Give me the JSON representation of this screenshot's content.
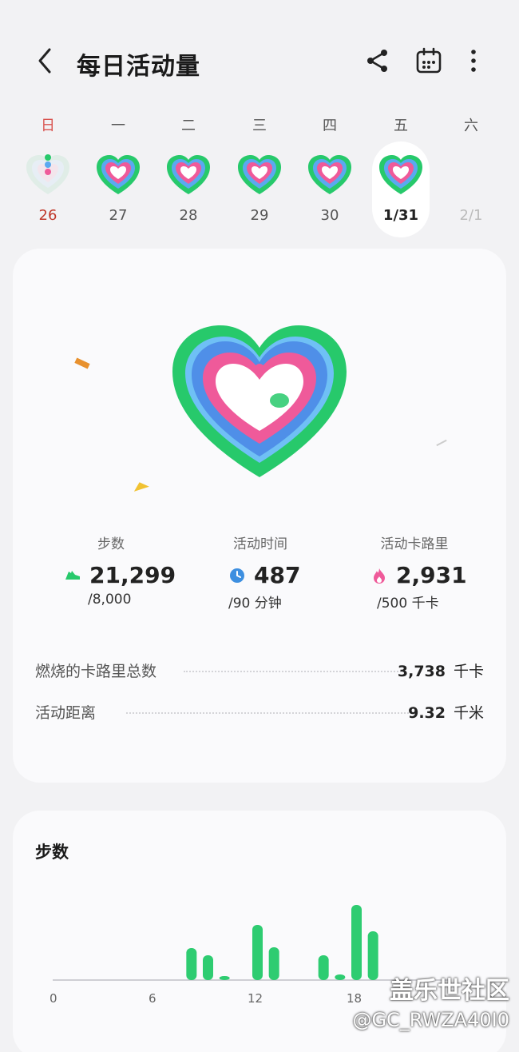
{
  "header": {
    "title": "每日活动量",
    "icons": [
      "back-chevron-icon",
      "share-icon",
      "calendar-icon",
      "more-vertical-icon"
    ]
  },
  "week": {
    "days": [
      {
        "dow": "日",
        "date": "26",
        "dow_color": "#d9534f",
        "date_color": "#c0392b",
        "faded_ring": true
      },
      {
        "dow": "一",
        "date": "27"
      },
      {
        "dow": "二",
        "date": "28"
      },
      {
        "dow": "三",
        "date": "29"
      },
      {
        "dow": "四",
        "date": "30"
      },
      {
        "dow": "五",
        "date": "1/31",
        "selected": true
      },
      {
        "dow": "六",
        "date": "2/1",
        "future": true
      }
    ]
  },
  "summary": {
    "steps": {
      "label": "步数",
      "value": "21,299",
      "goal": "/8,000",
      "icon": "shoe-icon"
    },
    "active_time": {
      "label": "活动时间",
      "value": "487",
      "goal": "/90 分钟",
      "icon": "clock-icon"
    },
    "active_calories": {
      "label": "活动卡路里",
      "value": "2,931",
      "goal": "/500 千卡",
      "icon": "flame-icon"
    },
    "details": [
      {
        "label": "燃烧的卡路里总数",
        "value": "3,738",
        "unit": "千卡"
      },
      {
        "label": "活动距离",
        "value": "9.32",
        "unit": "千米"
      }
    ]
  },
  "steps_chart": {
    "title": "步数",
    "chart_data": {
      "type": "bar",
      "x": [
        8,
        9,
        10,
        12,
        13,
        16,
        17,
        18,
        19
      ],
      "values": [
        40,
        31,
        5,
        69,
        41,
        31,
        7,
        94,
        61
      ],
      "xticks": [
        "0",
        "6",
        "12",
        "18"
      ],
      "xlim": [
        0,
        24
      ],
      "bar_color": "#2ecc71"
    }
  },
  "watermark": {
    "line1": "盖乐世社区",
    "line2": "@GC_RWZA40I0"
  },
  "colors": {
    "green": "#27c96b",
    "blue": "#5aa9f0",
    "pink": "#ef5a9a",
    "background": "#f2f2f4"
  }
}
